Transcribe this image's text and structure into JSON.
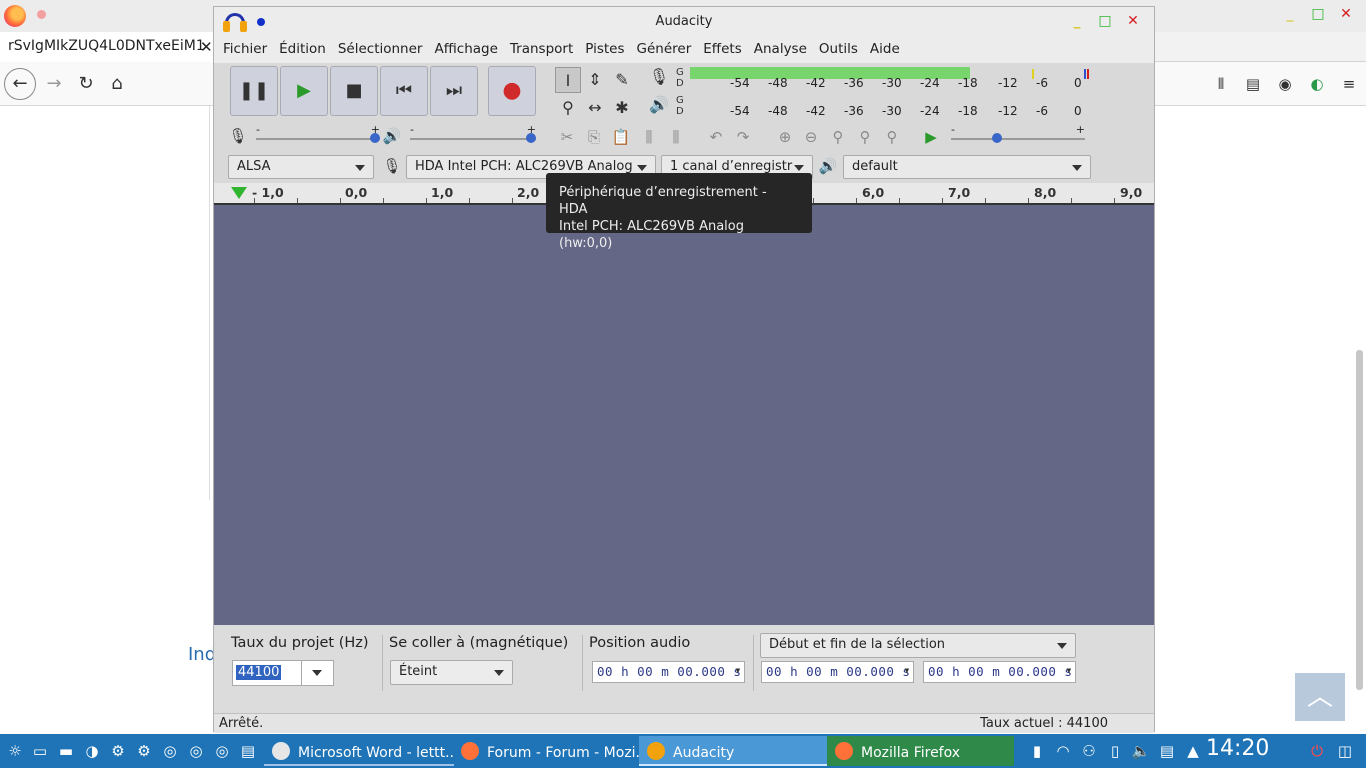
{
  "firefox": {
    "tab_title": "rSvIgMIkZUQ4L0DNTxeEiM1",
    "tab_close": "✕",
    "partial_text": "Ind",
    "icons": [
      "firefox-logo",
      "back-icon",
      "forward-icon",
      "reload-icon",
      "home-icon",
      "library-icon",
      "sidebar-icon",
      "account-icon",
      "extension-icon",
      "menu-icon"
    ]
  },
  "audacity": {
    "title": "Audacity",
    "menu": [
      "Fichier",
      "Édition",
      "Sélectionner",
      "Affichage",
      "Transport",
      "Pistes",
      "Générer",
      "Effets",
      "Analyse",
      "Outils",
      "Aide"
    ],
    "meter": {
      "channel_labels": [
        "G",
        "D"
      ],
      "scale": [
        "-54",
        "-48",
        "-42",
        "-36",
        "-30",
        "-24",
        "-18",
        "-12",
        "-6",
        "0"
      ],
      "record_level": 0.7
    },
    "sliders": {
      "min_label": "-",
      "max_label": "+"
    },
    "devices": {
      "host": "ALSA",
      "recording_device": "HDA Intel PCH: ALC269VB Analog",
      "channels": "1 canal d’enregistr",
      "playback_device": "default"
    },
    "ruler": {
      "labels": [
        "- 1,0",
        "0,0",
        "1,0",
        "2,0",
        "6,0",
        "7,0",
        "8,0",
        "9,0"
      ]
    },
    "tooltip": {
      "line1": "Périphérique d’enregistrement - HDA",
      "line2": "Intel PCH: ALC269VB Analog (hw:0,0)"
    },
    "selection_toolbar": {
      "rate_label": "Taux du projet (Hz)",
      "rate_value": "44100",
      "snap_label": "Se coller à (magnétique)",
      "snap_value": "Éteint",
      "position_label": "Position audio",
      "selection_mode": "Début et fin de la sélection",
      "audio_position": "00 h 00 m 00.000 s",
      "selection_start": "00 h 00 m 00.000 s",
      "selection_end": "00 h 00 m 00.000 s"
    },
    "status": {
      "state": "Arrêté.",
      "rate": "Taux actuel : 44100"
    }
  },
  "taskbar": {
    "tasks": [
      {
        "label": "Microsoft Word - lettt...",
        "icon": "word-icon"
      },
      {
        "label": "Forum - Forum - Mozi...",
        "icon": "firefox-icon"
      },
      {
        "label": "Audacity",
        "icon": "audacity-icon"
      },
      {
        "label": "Mozilla Firefox",
        "icon": "firefox-icon"
      }
    ],
    "clock": "14:20"
  },
  "colors": {
    "track_bg": "#646785",
    "taskbar": "#1e74b6",
    "meter_green": "#77d56b",
    "record_red": "#d02a2a"
  }
}
